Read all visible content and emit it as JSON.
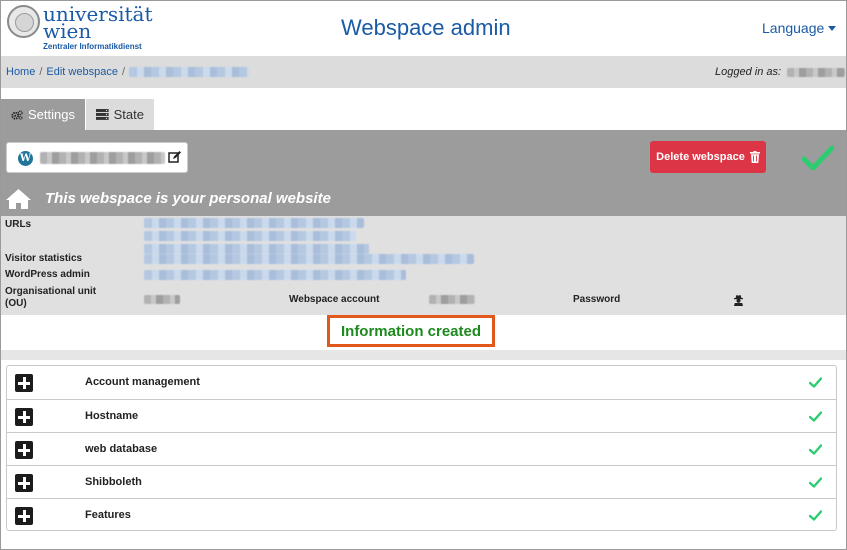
{
  "header": {
    "logo": {
      "line1": "universität",
      "line2": "wien",
      "subtitle": "Zentraler Informatikdienst"
    },
    "title": "Webspace admin",
    "language_label": "Language"
  },
  "breadcrumb": {
    "home": "Home",
    "edit_webspace": "Edit webspace",
    "separator": "/",
    "logged_in_label": "Logged in as:"
  },
  "tabs": [
    {
      "label": "Settings",
      "icon": "cogs-icon",
      "active": true
    },
    {
      "label": "State",
      "icon": "server-icon",
      "active": false
    }
  ],
  "panel": {
    "delete_label": "Delete webspace",
    "personal_text": "This webspace is your personal website"
  },
  "info": {
    "urls_label": "URLs",
    "visitor_statistics_label": "Visitor statistics",
    "wordpress_admin_label": "WordPress admin",
    "organisational_unit_label": "Organisational unit",
    "organisational_unit_abbr": "(OU)",
    "webspace_account_label": "Webspace account",
    "password_label": "Password"
  },
  "message": {
    "created": "Information created"
  },
  "sections": [
    {
      "label": "Account management"
    },
    {
      "label": "Hostname"
    },
    {
      "label": "web database"
    },
    {
      "label": "Shibboleth"
    },
    {
      "label": "Features"
    }
  ],
  "colors": {
    "brand_blue": "#1a5aa6",
    "danger_red": "#dc3545",
    "success_green": "#2ecc71",
    "highlight_orange": "#e2571b",
    "created_green": "#1c8a1c"
  }
}
